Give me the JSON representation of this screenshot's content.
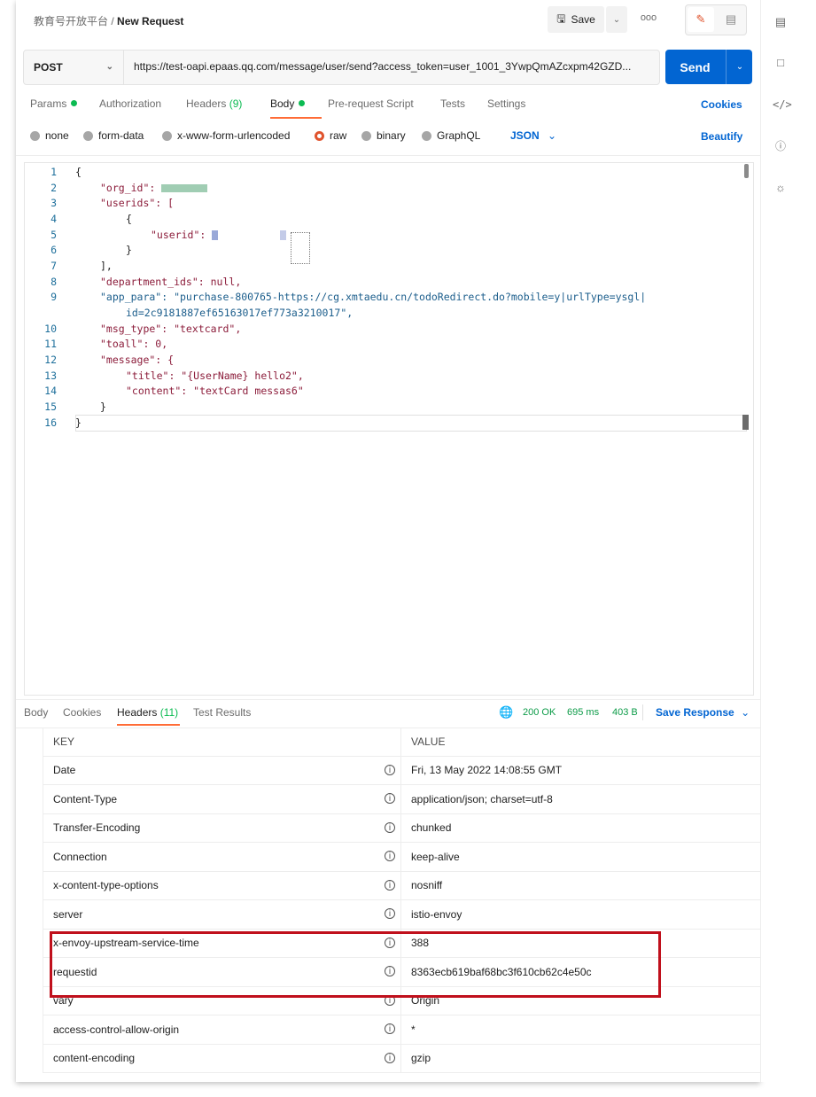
{
  "breadcrumb": {
    "workspace": "教育号开放平台",
    "separator": "/",
    "request_name": "New Request"
  },
  "toolbar": {
    "save_label": "Save",
    "more_label": "ooo"
  },
  "request": {
    "method": "POST",
    "url": "https://test-oapi.epaas.qq.com/message/user/send?access_token=user_1001_3YwpQmAZcxpm42GZD...",
    "send_label": "Send"
  },
  "tabs": [
    {
      "label": "Params",
      "indicator": "dot"
    },
    {
      "label": "Authorization"
    },
    {
      "label": "Headers",
      "count": "(9)"
    },
    {
      "label": "Body",
      "indicator": "dot",
      "active": true
    },
    {
      "label": "Pre-request Script"
    },
    {
      "label": "Tests"
    },
    {
      "label": "Settings"
    }
  ],
  "cookies_label": "Cookies",
  "body_types": [
    "none",
    "form-data",
    "x-www-form-urlencoded",
    "raw",
    "binary",
    "GraphQL"
  ],
  "body_selected": "raw",
  "body_format": "JSON",
  "beautify_label": "Beautify",
  "editor": {
    "line_numbers": [
      "1",
      "2",
      "3",
      "4",
      "5",
      "6",
      "7",
      "8",
      "9",
      "",
      "10",
      "11",
      "12",
      "13",
      "14",
      "15",
      "16"
    ],
    "lines": [
      "{",
      "\"org_id\": ",
      "\"userids\": [",
      "{",
      "\"userid\": ",
      "}",
      "],",
      "\"department_ids\": null,",
      "\"app_para\": \"purchase-800765-https://cg.xmtaedu.cn/todoRedirect.do?mobile=y|urlType=ysgl|",
      "id=2c9181887ef65163017ef773a3210017\",",
      "\"msg_type\": \"textcard\",",
      "\"toall\": 0,",
      "\"message\": {",
      "\"title\": \"{UserName} hello2\",",
      "\"content\": \"textCard messas6\"",
      "}",
      "}"
    ]
  },
  "response": {
    "tabs": [
      "Body",
      "Cookies",
      "Headers",
      "Test Results"
    ],
    "headers_count": "(11)",
    "status": "200 OK",
    "time": "695 ms",
    "size": "403 B",
    "save_label": "Save Response",
    "table_headers": {
      "key": "KEY",
      "value": "VALUE"
    },
    "rows": [
      {
        "key": "Date",
        "value": "Fri, 13 May 2022 14:08:55 GMT"
      },
      {
        "key": "Content-Type",
        "value": "application/json; charset=utf-8"
      },
      {
        "key": "Transfer-Encoding",
        "value": "chunked"
      },
      {
        "key": "Connection",
        "value": "keep-alive"
      },
      {
        "key": "x-content-type-options",
        "value": "nosniff"
      },
      {
        "key": "server",
        "value": "istio-envoy"
      },
      {
        "key": "x-envoy-upstream-service-time",
        "value": "388"
      },
      {
        "key": "requestid",
        "value": "8363ecb619baf68bc3f610cb62c4e50c"
      },
      {
        "key": "vary",
        "value": "Origin"
      },
      {
        "key": "access-control-allow-origin",
        "value": "*"
      },
      {
        "key": "content-encoding",
        "value": "gzip"
      }
    ]
  },
  "colors": {
    "accent": "#ff6c37",
    "primary": "#0265d2",
    "success": "#0cbb52",
    "highlight": "#c0101c"
  },
  "icons": [
    "save-icon",
    "chevron-down-icon",
    "more-icon",
    "edit-icon",
    "comment-icon",
    "documentation-icon",
    "code-icon",
    "info-icon",
    "lightbulb-icon",
    "globe-icon"
  ]
}
